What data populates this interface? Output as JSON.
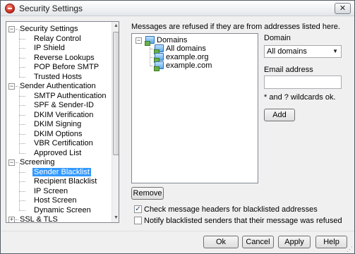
{
  "window": {
    "title": "Security Settings",
    "close_glyph": "✕"
  },
  "tree": {
    "items": [
      {
        "label": "Security Settings",
        "level": 0,
        "expanded": true
      },
      {
        "label": "Relay Control",
        "level": 1
      },
      {
        "label": "IP Shield",
        "level": 1
      },
      {
        "label": "Reverse Lookups",
        "level": 1
      },
      {
        "label": "POP Before SMTP",
        "level": 1
      },
      {
        "label": "Trusted Hosts",
        "level": 1
      },
      {
        "label": "Sender Authentication",
        "level": 0,
        "expanded": true
      },
      {
        "label": "SMTP Authentication",
        "level": 1
      },
      {
        "label": "SPF & Sender-ID",
        "level": 1
      },
      {
        "label": "DKIM Verification",
        "level": 1
      },
      {
        "label": "DKIM Signing",
        "level": 1
      },
      {
        "label": "DKIM Options",
        "level": 1
      },
      {
        "label": "VBR Certification",
        "level": 1
      },
      {
        "label": "Approved List",
        "level": 1
      },
      {
        "label": "Screening",
        "level": 0,
        "expanded": true
      },
      {
        "label": "Sender Blacklist",
        "level": 1,
        "selected": true
      },
      {
        "label": "Recipient Blacklist",
        "level": 1
      },
      {
        "label": "IP Screen",
        "level": 1
      },
      {
        "label": "Host Screen",
        "level": 1
      },
      {
        "label": "Dynamic Screen",
        "level": 1
      },
      {
        "label": "SSL & TLS",
        "level": 0,
        "expanded": false
      }
    ]
  },
  "blacklist": {
    "info_text": "Messages are refused if they are from addresses listed here.",
    "root_label": "Domains",
    "domains": [
      "All domains",
      "example.org",
      "example.com"
    ]
  },
  "form": {
    "domain_label": "Domain",
    "domain_selected": "All domains",
    "email_label": "Email address",
    "email_value": "",
    "wildcard_note": "* and ? wildcards ok.",
    "add_label": "Add",
    "remove_label": "Remove"
  },
  "options": {
    "check_headers_label": "Check message headers for blacklisted addresses",
    "check_headers_checked": true,
    "notify_label": "Notify blacklisted senders that their message was refused",
    "notify_checked": false
  },
  "buttons": {
    "ok": "Ok",
    "cancel": "Cancel",
    "apply": "Apply",
    "help": "Help"
  },
  "colors": {
    "selection": "#3399ff",
    "window_bg": "#f0f0f0",
    "check_mark": "#22406b"
  }
}
